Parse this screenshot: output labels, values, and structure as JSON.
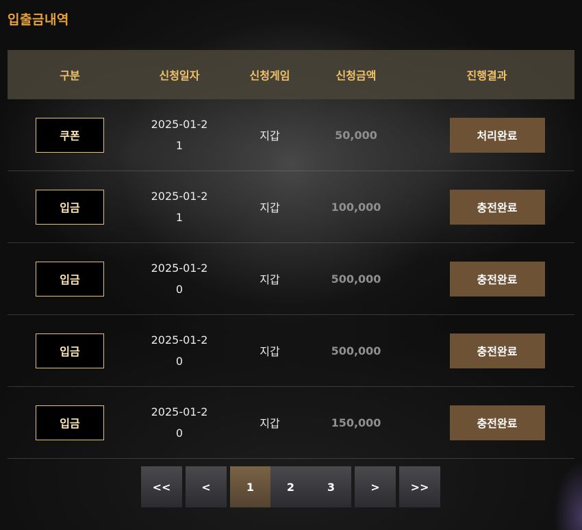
{
  "page": {
    "title": "입출금내역"
  },
  "table": {
    "headers": [
      "구분",
      "신청일자",
      "신청게임",
      "신청금액",
      "진행결과"
    ],
    "rows": [
      {
        "type": "쿠폰",
        "date": "2025-01-21",
        "game": "지갑",
        "amount": "50,000",
        "status": "처리완료"
      },
      {
        "type": "입금",
        "date": "2025-01-21",
        "game": "지갑",
        "amount": "100,000",
        "status": "충전완료"
      },
      {
        "type": "입금",
        "date": "2025-01-20",
        "game": "지갑",
        "amount": "500,000",
        "status": "충전완료"
      },
      {
        "type": "입금",
        "date": "2025-01-20",
        "game": "지갑",
        "amount": "500,000",
        "status": "충전완료"
      },
      {
        "type": "입금",
        "date": "2025-01-20",
        "game": "지갑",
        "amount": "150,000",
        "status": "충전완료"
      }
    ]
  },
  "pagination": {
    "first": "<<",
    "prev": "<",
    "pages": [
      "1",
      "2",
      "3"
    ],
    "current": "1",
    "next": ">",
    "last": ">>"
  },
  "colors": {
    "title": "#e8a33a",
    "header_bg": "#4a4438",
    "header_text": "#f0c36b",
    "badge_border": "#e7c27a",
    "status_bg": "#6d5235",
    "pager_active": "#7a6346"
  }
}
